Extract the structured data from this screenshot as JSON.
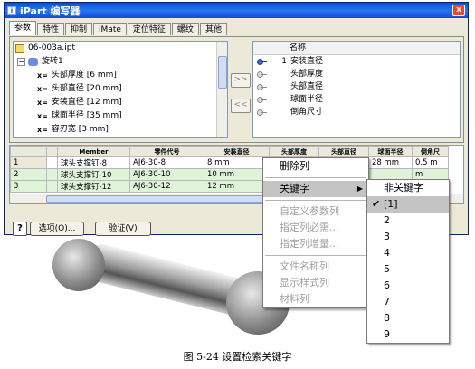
{
  "window": {
    "title": "iPart 编写器",
    "close_label": "x"
  },
  "tabs": [
    "参数",
    "特性",
    "抑制",
    "iMate",
    "定位特征",
    "螺纹",
    "其他"
  ],
  "tree": {
    "items": [
      {
        "label": "06-003a.ipt",
        "icon": "part-file-icon"
      },
      {
        "label": "旋转1",
        "icon": "revolve-icon"
      },
      {
        "label": "头部厚度 [6 mm]",
        "icon": "parameter-x-icon"
      },
      {
        "label": "头部直径 [20 mm]",
        "icon": "parameter-x-icon"
      },
      {
        "label": "安装直径 [12 mm]",
        "icon": "parameter-x-icon"
      },
      {
        "label": "球面半径 [35 mm]",
        "icon": "parameter-x-icon"
      },
      {
        "label": "容刃宽 [3 mm]",
        "icon": "parameter-x-icon"
      }
    ],
    "param_prefix": "x="
  },
  "buttons": {
    "add": ">>",
    "remove": "<<",
    "options": "选项(O)...",
    "verify": "验证(V)",
    "help": "?"
  },
  "params": {
    "header": "名称",
    "items": [
      {
        "num": "1",
        "label": "安装直径",
        "key": true
      },
      {
        "num": "",
        "label": "头部厚度",
        "key": false
      },
      {
        "num": "",
        "label": "头部直径",
        "key": false
      },
      {
        "num": "",
        "label": "球面半径",
        "key": false
      },
      {
        "num": "",
        "label": "倒角尺寸",
        "key": false
      }
    ]
  },
  "grid": {
    "columns": [
      "",
      "",
      "Member",
      "零件代号",
      "安装直径",
      "头部厚度",
      "头部直径",
      "球面半径",
      "倒角尺"
    ],
    "rows": [
      [
        "1",
        "",
        "球头支撑钉-8",
        "AJ6-30-8",
        "8 mm",
        "",
        "",
        "28 mm",
        "0.5 m"
      ],
      [
        "2",
        "",
        "球头支撑钉-10",
        "AJ6-30-10",
        "10 mm",
        "",
        "",
        "",
        "m"
      ],
      [
        "3",
        "",
        "球头支撑钉-12",
        "AJ6-30-12",
        "12 mm",
        "",
        "",
        "",
        ""
      ]
    ]
  },
  "context_menu": {
    "items": [
      {
        "label": "删除列",
        "disabled": false
      },
      {
        "sep": true
      },
      {
        "label": "关键字",
        "disabled": false,
        "submenu": true,
        "highlight": true
      },
      {
        "sep": true
      },
      {
        "label": "自定义参数列",
        "disabled": true
      },
      {
        "label": "指定列必需...",
        "disabled": true
      },
      {
        "label": "指定列增量...",
        "disabled": true
      },
      {
        "sep": true
      },
      {
        "label": "文件名称列",
        "disabled": true
      },
      {
        "label": "显示样式列",
        "disabled": true
      },
      {
        "label": "材料列",
        "disabled": true
      }
    ]
  },
  "submenu": {
    "items": [
      "非关键字",
      "[1]",
      "2",
      "3",
      "4",
      "5",
      "6",
      "7",
      "8",
      "9"
    ],
    "checked_index": 1
  },
  "caption": "图 5-24  设置检索关键字"
}
